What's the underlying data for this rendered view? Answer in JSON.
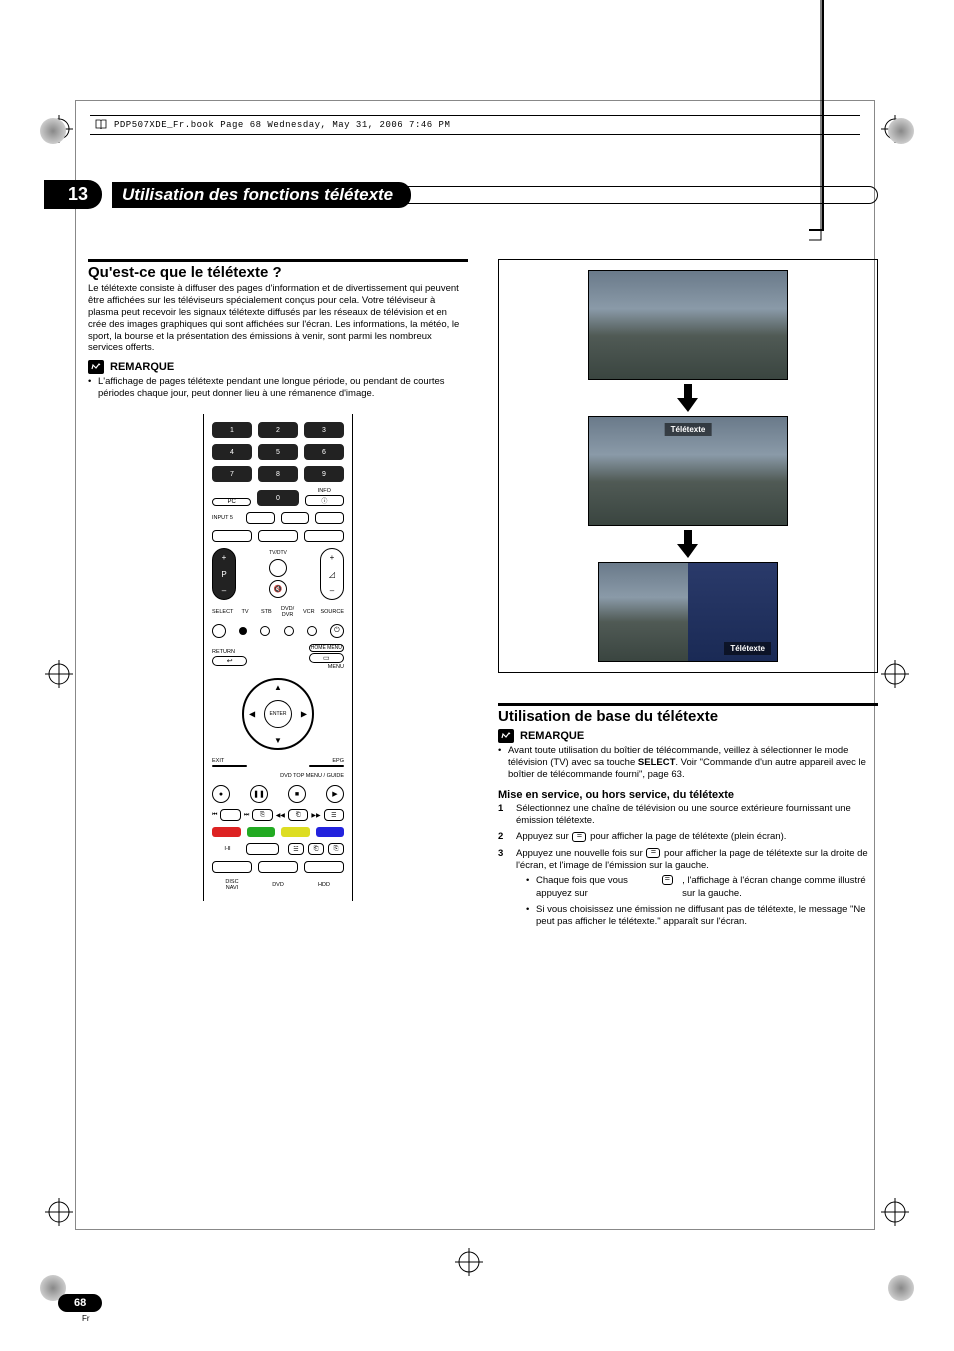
{
  "header": {
    "filename_line": "PDP507XDE_Fr.book  Page 68  Wednesday, May 31, 2006  7:46 PM"
  },
  "chapter": {
    "number": "13",
    "title": "Utilisation des fonctions télétexte"
  },
  "section1": {
    "title": "Qu'est-ce que le télétexte ?",
    "body": "Le télétexte consiste à diffuser des pages d'information et de divertissement qui peuvent être affichées sur les téléviseurs spécialement conçus pour cela. Votre téléviseur à plasma peut recevoir les signaux télétexte diffusés par les réseaux de télévision et en crée des images graphiques qui sont affichées sur l'écran. Les informations, la météo, le sport, la bourse et la présentation des émissions à venir, sont parmi les nombreux services offerts.",
    "note_label": "REMARQUE",
    "note_bullet": "L'affichage de pages télétexte pendant une longue période, ou pendant de courtes périodes chaque jour, peut donner lieu à une rémanence d'image."
  },
  "remote": {
    "keys": {
      "k1": "1",
      "k2": "2",
      "k3": "3",
      "k4": "4",
      "k5": "5",
      "k6": "6",
      "k7": "7",
      "k8": "8",
      "k9": "9",
      "k0": "0",
      "pc": "PC",
      "info": "INFO",
      "input5": "INPUT 5",
      "tvdtv": "TV/DTV",
      "p": "P",
      "select": "SELECT",
      "tv": "TV",
      "stb": "STB",
      "dvd_dvr": "DVD/\nDVR",
      "vcr": "VCR",
      "source": "SOURCE",
      "return": "RETURN",
      "home_menu": "HOME MENU",
      "menu": "MENU",
      "enter": "ENTER",
      "exit": "EXIT",
      "epg": "EPG",
      "dvd_top_menu_guide": "DVD TOP MENU / GUIDE",
      "disc_navi": "DISC\nNAVI",
      "dvd": "DVD",
      "hdd": "HDD",
      "plus": "+",
      "minus": "–"
    }
  },
  "figures": {
    "label_teletext_full": "Télétexte",
    "label_teletext_half": "Télétexte"
  },
  "section2": {
    "title": "Utilisation de base du télétexte",
    "note_label": "REMARQUE",
    "note_bullet_prefix": "Avant toute utilisation du boîtier de télécommande, veillez à sélectionner le mode télévision (TV) avec sa touche ",
    "note_bullet_bold": "SELECT",
    "note_bullet_suffix": ". Voir \"Commande d'un autre appareil avec le boîtier de télécommande fourni\", page 63.",
    "sub_heading": "Mise en service, ou hors service, du télétexte",
    "step1": "Sélectionnez une chaîne de télévision ou une source extérieure fournissant une émission télétexte.",
    "step2_prefix": "Appuyez sur ",
    "step2_suffix": " pour afficher la page de télétexte (plein écran).",
    "step3_prefix": "Appuyez une nouvelle fois sur ",
    "step3_suffix": " pour afficher la page de télétexte sur la droite de l'écran, et l'image de l'émission sur la gauche.",
    "step3_sub1_prefix": "Chaque fois que vous appuyez sur ",
    "step3_sub1_suffix": ", l'affichage à l'écran change comme illustré sur la gauche.",
    "step3_sub2": "Si vous choisissez une émission ne diffusant pas de télétexte, le message \"Ne peut pas afficher le télétexte.\" apparaît sur l'écran."
  },
  "footer": {
    "page": "68",
    "lang": "Fr"
  }
}
